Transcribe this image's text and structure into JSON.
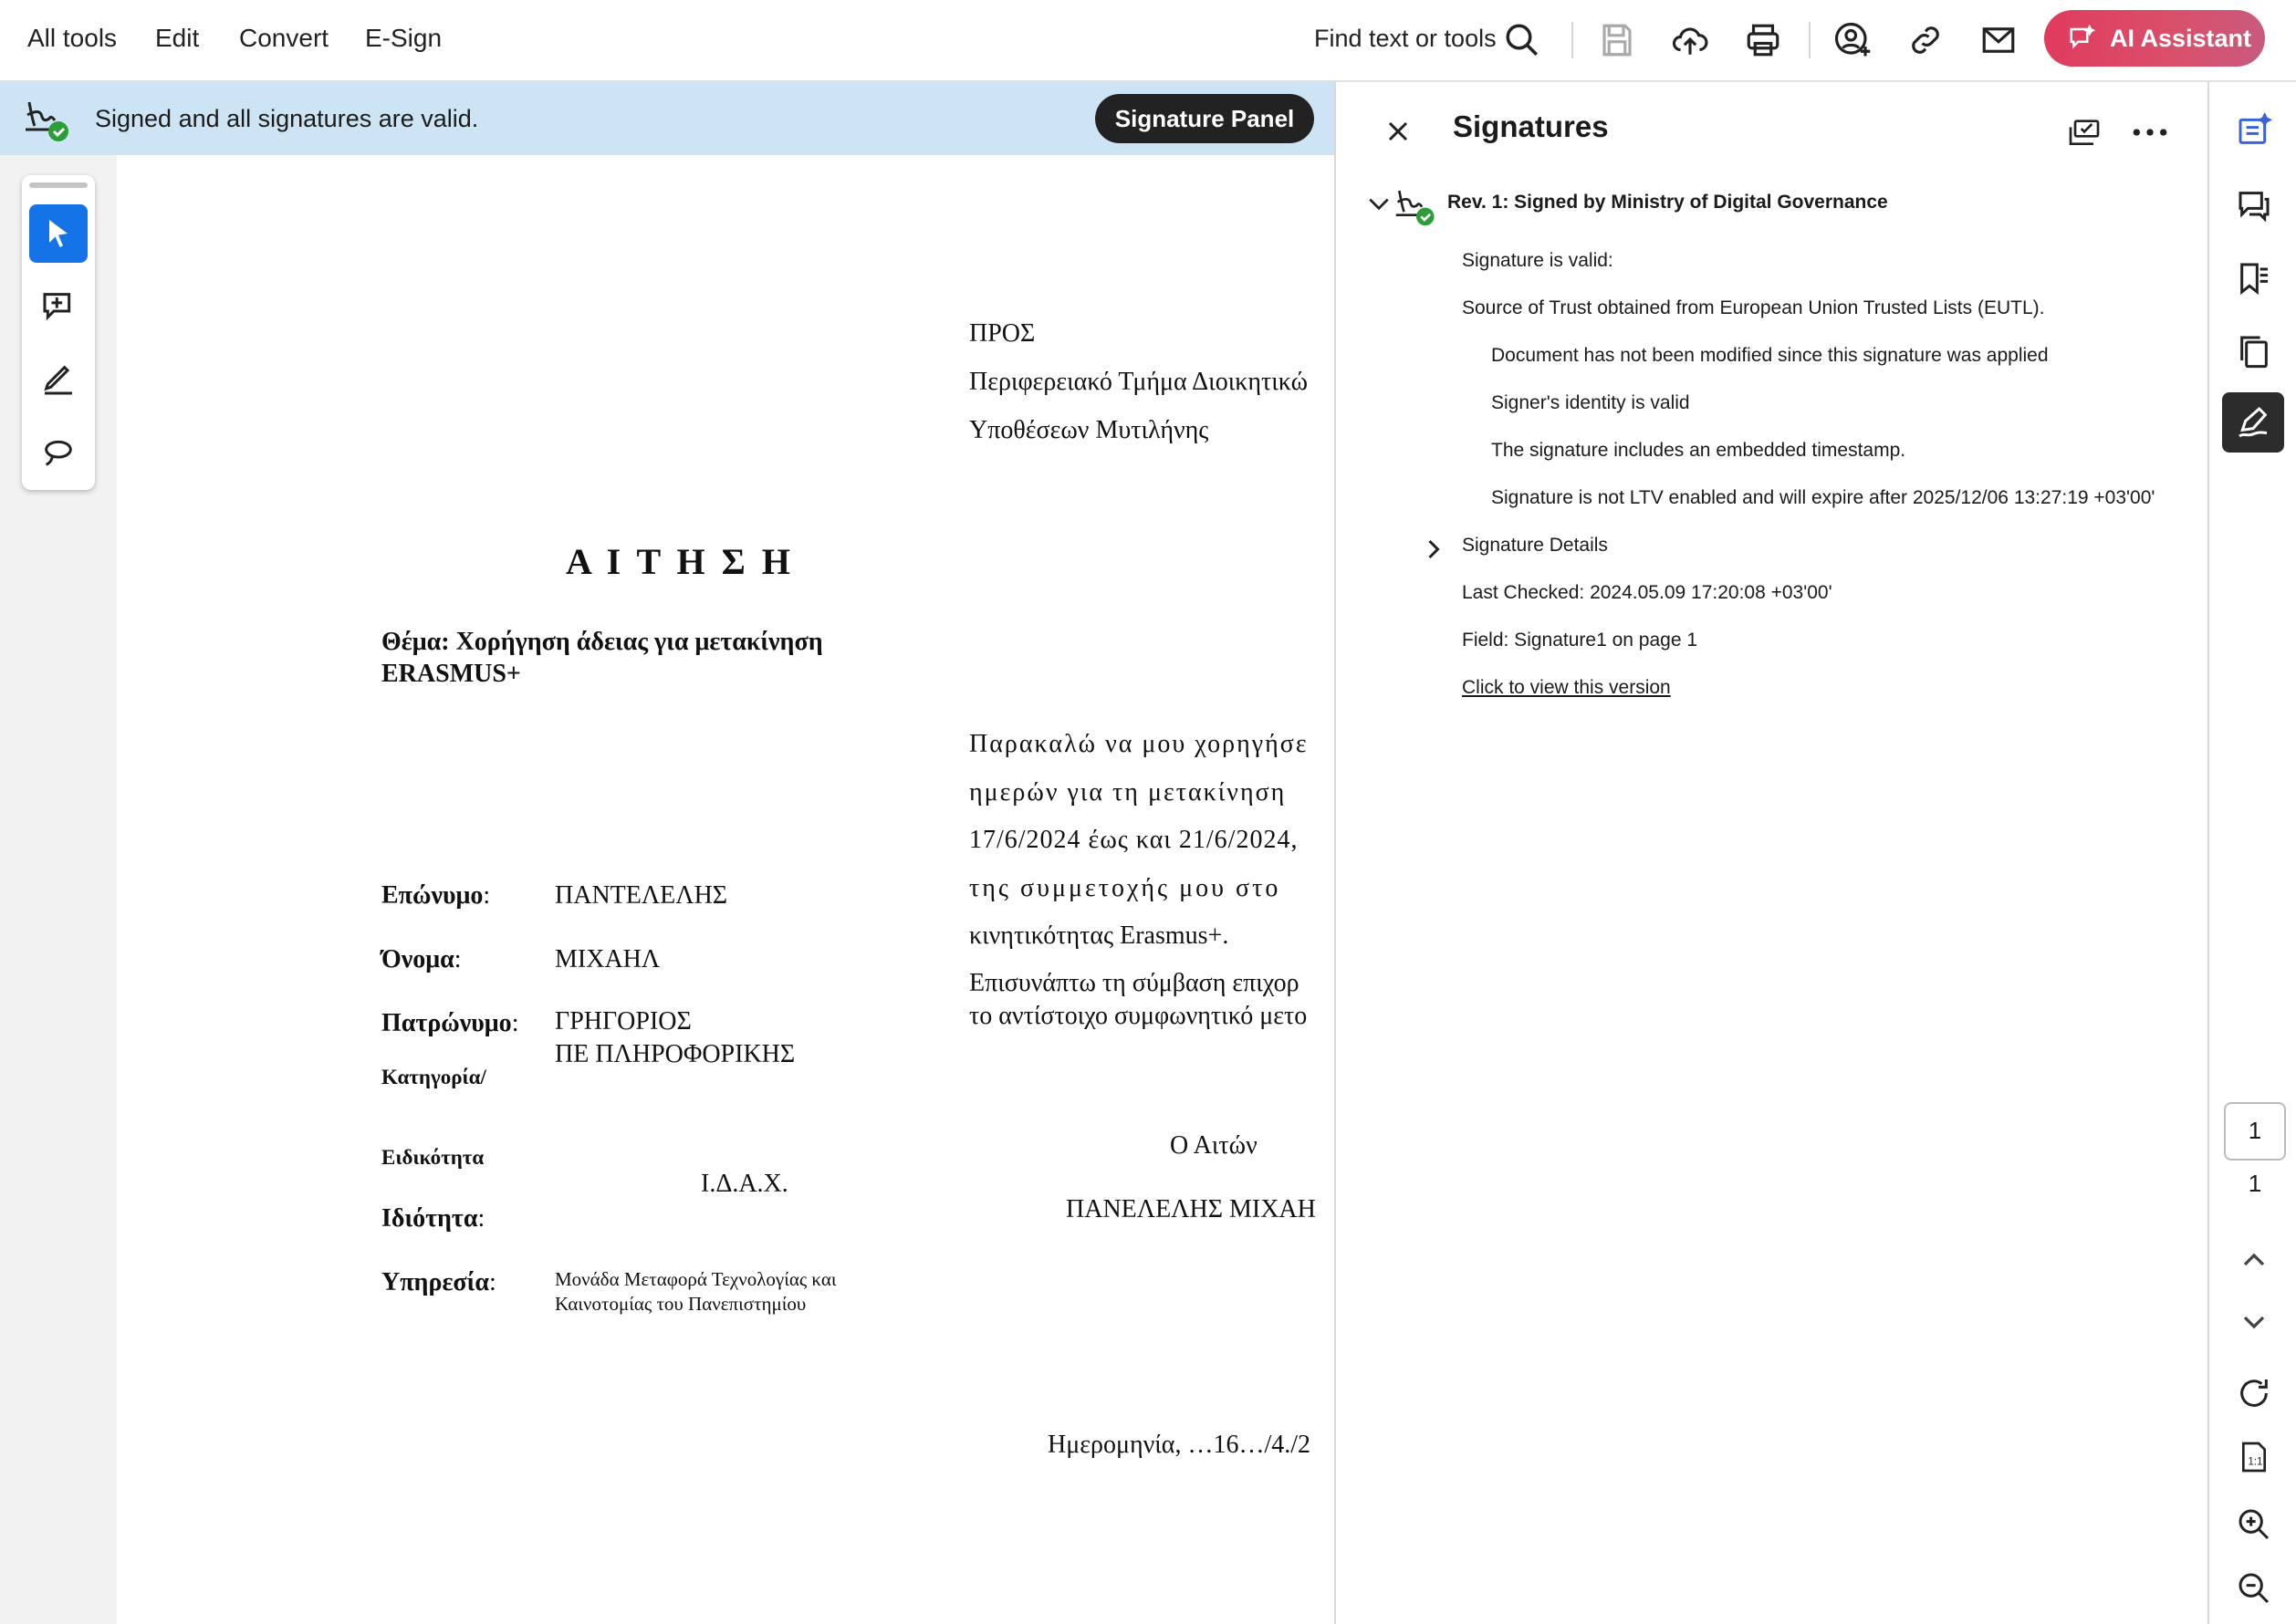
{
  "topbar": {
    "menu": [
      "All tools",
      "Edit",
      "Convert",
      "E-Sign"
    ],
    "find_placeholder": "Find text or tools",
    "ai_label": "AI Assistant",
    "icons": [
      "search-icon",
      "save-icon",
      "cloud-upload-icon",
      "print-icon",
      "add-user-icon",
      "link-icon",
      "mail-icon"
    ]
  },
  "banner": {
    "text": "Signed and all signatures are valid.",
    "button": "Signature Panel"
  },
  "tools": [
    "select-tool",
    "add-comment-tool",
    "highlight-pen-tool",
    "lasso-tool"
  ],
  "document": {
    "recipient": [
      "ΠΡΟΣ",
      "Περιφερειακό Τμήμα Διοικητικώ",
      "Υποθέσεων Μυτιλήνης"
    ],
    "heading": "Α Ι Τ Η Σ Η",
    "subject_line1": "Θέμα: Χορήγηση άδειας για μετακίνηση",
    "subject_line2": "ERASMUS+",
    "body_lines": [
      "Παρακαλώ να μου χορηγήσε",
      "ημερών για τη μετακίνηση",
      "17/6/2024 έως και 21/6/2024,",
      "της συμμετοχής μου στο",
      "κινητικότητας Erasmus+."
    ],
    "attach_lines": [
      "Επισυνάπτω τη σύμβαση επιχορ",
      "το αντίστοιχο συμφωνητικό μετο"
    ],
    "fields": {
      "surname_label": "Επώνυμο",
      "surname_value": "ΠΑΝΤΕΛΕΛΗΣ",
      "name_label": "Όνομα",
      "name_value": "ΜΙΧΑΗΛ",
      "father_label": "Πατρώνυμο",
      "father_value": "ΓΡΗΓΟΡΙΟΣ",
      "category_value": "ΠΕ ΠΛΗΡΟΦΟΡΙΚΗΣ",
      "category_label": "Κατηγορία/",
      "specialty_label": "Ειδικότητα",
      "idax": "Ι.Δ.Α.Χ.",
      "status_label": "Ιδιότητα",
      "service_label": "Υπηρεσία",
      "service_line1": "Μονάδα Μεταφορά Τεχνολογίας και",
      "service_line2": "Καινοτομίας του Πανεπιστημίου"
    },
    "applicant_label": "Ο Αιτών",
    "applicant_name": "ΠΑΝΕΛΕΛΗΣ ΜΙΧΑΗ",
    "date_line": "Ημερομηνία, …16…/4./2",
    "colon": ":"
  },
  "panel": {
    "title": "Signatures",
    "rev_title": "Rev. 1: Signed by Ministry of Digital Governance",
    "valid": "Signature is valid:",
    "trust": "Source of Trust obtained from European Union Trusted Lists (EUTL).",
    "checks": [
      "Document has not been modified since this signature was applied",
      "Signer's identity is valid",
      "The signature includes an embedded timestamp.",
      "Signature is not LTV enabled and will expire after 2025/12/06 13:27:19 +03'00'"
    ],
    "details": "Signature Details",
    "last_checked": "Last Checked: 2024.05.09 17:20:08 +03'00'",
    "field": "Field: Signature1 on page 1",
    "view_link": "Click to view this version"
  },
  "rail": {
    "icons": [
      "edit-pdf-icon",
      "comment-icon",
      "bookmark-icon",
      "pages-icon",
      "sign-icon"
    ],
    "page_current": "1",
    "page_total": "1"
  },
  "colors": {
    "banner": "#cde4f5",
    "accent_blue": "#1473e6",
    "valid_green": "#2d9d3a",
    "ai_gradient_start": "#e03b5e"
  }
}
